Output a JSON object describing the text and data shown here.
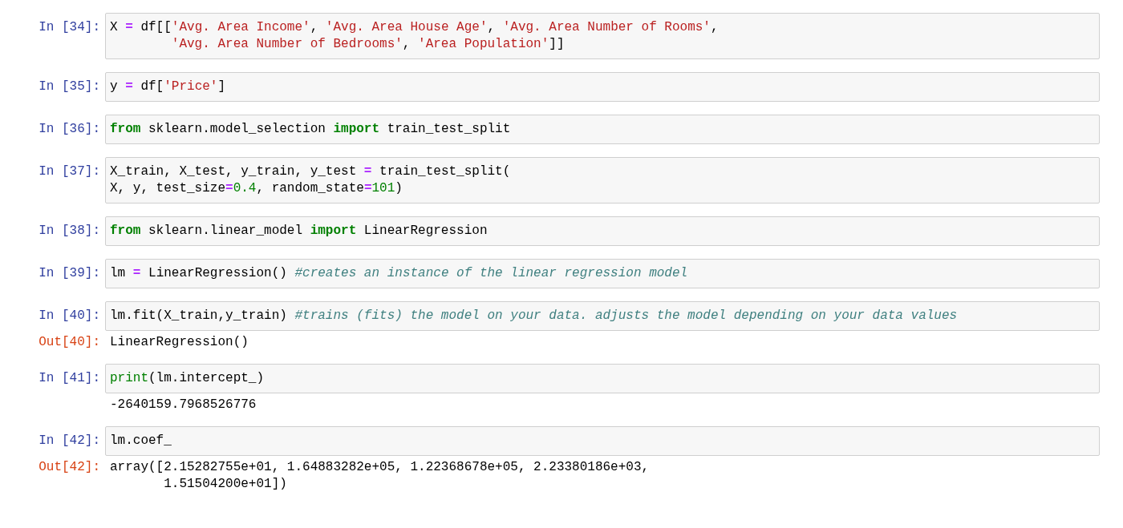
{
  "cells": [
    {
      "prompt": "In [34]:",
      "code": [
        {
          "tokens": [
            {
              "kind": "plain",
              "t": "X "
            },
            {
              "kind": "op",
              "t": "="
            },
            {
              "kind": "plain",
              "t": " df[["
            },
            {
              "kind": "str",
              "t": "'Avg. Area Income'"
            },
            {
              "kind": "plain",
              "t": ", "
            },
            {
              "kind": "str",
              "t": "'Avg. Area House Age'"
            },
            {
              "kind": "plain",
              "t": ", "
            },
            {
              "kind": "str",
              "t": "'Avg. Area Number of Rooms'"
            },
            {
              "kind": "plain",
              "t": ","
            }
          ]
        },
        {
          "hanging": true,
          "tokens": [
            {
              "kind": "str",
              "t": "'Avg. Area Number of Bedrooms'"
            },
            {
              "kind": "plain",
              "t": ", "
            },
            {
              "kind": "str",
              "t": "'Area Population'"
            },
            {
              "kind": "plain",
              "t": "]]"
            }
          ]
        }
      ]
    },
    {
      "prompt": "In [35]:",
      "code": [
        {
          "tokens": [
            {
              "kind": "plain",
              "t": "y "
            },
            {
              "kind": "op",
              "t": "="
            },
            {
              "kind": "plain",
              "t": " df["
            },
            {
              "kind": "str",
              "t": "'Price'"
            },
            {
              "kind": "plain",
              "t": "]"
            }
          ]
        }
      ]
    },
    {
      "prompt": "In [36]:",
      "code": [
        {
          "tokens": [
            {
              "kind": "kw",
              "t": "from"
            },
            {
              "kind": "plain",
              "t": " sklearn.model_selection "
            },
            {
              "kind": "kw",
              "t": "import"
            },
            {
              "kind": "plain",
              "t": " train_test_split"
            }
          ]
        }
      ]
    },
    {
      "prompt": "In [37]:",
      "code": [
        {
          "tokens": [
            {
              "kind": "plain",
              "t": "X_train, X_test, y_train, y_test "
            },
            {
              "kind": "op",
              "t": "="
            },
            {
              "kind": "plain",
              "t": " train_test_split("
            }
          ]
        },
        {
          "tokens": [
            {
              "kind": "plain",
              "t": "X, y, test_size"
            },
            {
              "kind": "op",
              "t": "="
            },
            {
              "kind": "num",
              "t": "0.4"
            },
            {
              "kind": "plain",
              "t": ", random_state"
            },
            {
              "kind": "op",
              "t": "="
            },
            {
              "kind": "num",
              "t": "101"
            },
            {
              "kind": "plain",
              "t": ")"
            }
          ]
        }
      ]
    },
    {
      "prompt": "In [38]:",
      "code": [
        {
          "tokens": [
            {
              "kind": "kw",
              "t": "from"
            },
            {
              "kind": "plain",
              "t": " sklearn.linear_model "
            },
            {
              "kind": "kw",
              "t": "import"
            },
            {
              "kind": "plain",
              "t": " LinearRegression"
            }
          ]
        }
      ]
    },
    {
      "prompt": "In [39]:",
      "code": [
        {
          "tokens": [
            {
              "kind": "plain",
              "t": "lm "
            },
            {
              "kind": "op",
              "t": "="
            },
            {
              "kind": "plain",
              "t": " LinearRegression() "
            },
            {
              "kind": "comment",
              "t": "#creates an instance of the linear regression model"
            }
          ]
        }
      ]
    },
    {
      "prompt": "In [40]:",
      "code": [
        {
          "tokens": [
            {
              "kind": "plain",
              "t": "lm.fit(X_train,y_train) "
            },
            {
              "kind": "comment",
              "t": "#trains (fits) the model on your data. adjusts the model depending on your data values"
            }
          ]
        }
      ],
      "output": {
        "prompt": "Out[40]:",
        "lines": [
          "LinearRegression()"
        ]
      }
    },
    {
      "prompt": "In [41]:",
      "code": [
        {
          "tokens": [
            {
              "kind": "builtin",
              "t": "print"
            },
            {
              "kind": "plain",
              "t": "(lm.intercept_)"
            }
          ]
        }
      ],
      "output": {
        "lines": [
          "-2640159.7968526776"
        ]
      }
    },
    {
      "prompt": "In [42]:",
      "code": [
        {
          "tokens": [
            {
              "kind": "plain",
              "t": "lm.coef_"
            }
          ]
        }
      ],
      "output": {
        "prompt": "Out[42]:",
        "lines": [
          "array([2.15282755e+01, 1.64883282e+05, 1.22368678e+05, 2.23380186e+03,",
          "       1.51504200e+01])"
        ]
      }
    }
  ]
}
